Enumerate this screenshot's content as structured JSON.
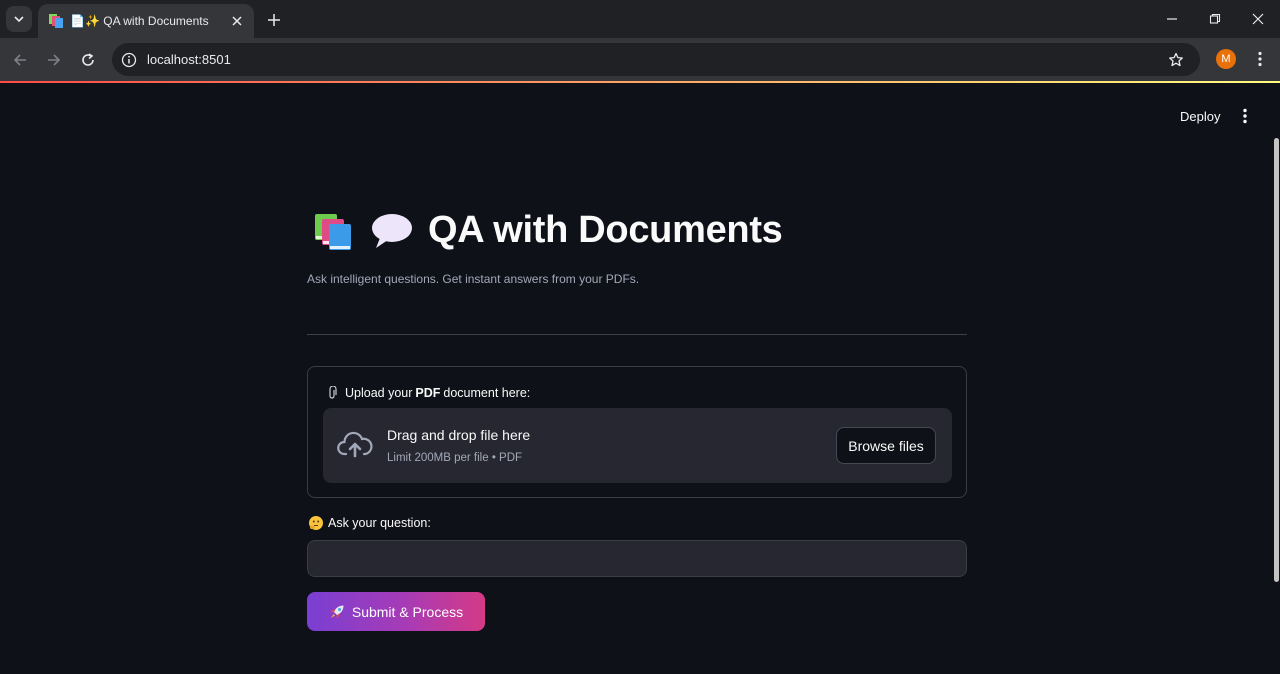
{
  "browser": {
    "tab": {
      "emoji_prefix": "📄✨",
      "title": "QA with Documents"
    },
    "address_bar": {
      "url": "localhost:8501"
    },
    "profile_initial": "M"
  },
  "app": {
    "toolbar": {
      "deploy_label": "Deploy"
    },
    "title": "QA with Documents",
    "subtitle": "Ask intelligent questions. Get instant answers from your PDFs.",
    "uploader": {
      "label_pre": "Upload your",
      "label_bold": "PDF",
      "label_post": "document here:",
      "drop_text": "Drag and drop file here",
      "limit_text": "Limit 200MB per file • PDF",
      "browse_label": "Browse files"
    },
    "question": {
      "label": "Ask your question:",
      "value": "",
      "placeholder": ""
    },
    "submit_label": "Submit & Process"
  },
  "colors": {
    "background": "#0e1117",
    "card": "#262730",
    "accent_start": "#7a3fd2",
    "accent_end": "#d43a86",
    "decoration_start": "#ff4b4b",
    "decoration_end": "#fffd80"
  },
  "icons": [
    "tab-search-icon",
    "favicon-books-icon",
    "close-icon",
    "plus-icon",
    "minimize-icon",
    "restore-icon",
    "back-icon",
    "forward-icon",
    "reload-icon",
    "info-icon",
    "star-icon",
    "kebab-icon",
    "books-icon",
    "speech-bubble-icon",
    "paperclip-icon",
    "cloud-upload-icon",
    "thinking-face-icon",
    "rocket-icon"
  ]
}
